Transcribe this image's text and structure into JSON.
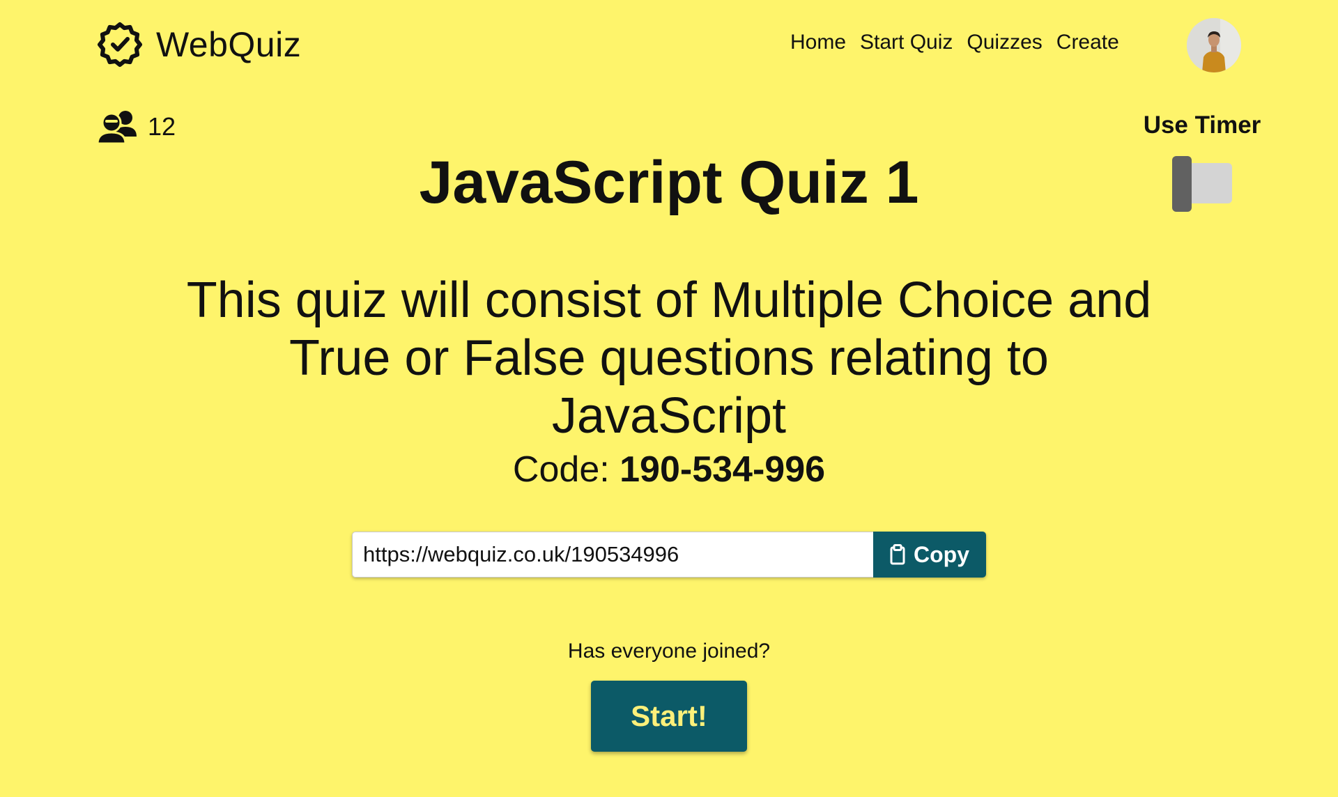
{
  "header": {
    "brand": "WebQuiz",
    "logo_icon": "badge-check-icon",
    "nav": [
      {
        "label": "Home"
      },
      {
        "label": "Start Quiz"
      },
      {
        "label": "Quizzes"
      },
      {
        "label": "Create"
      }
    ],
    "avatar_icon": "user-avatar"
  },
  "lobby": {
    "participants_icon": "users-icon",
    "participant_count": "12",
    "timer_label": "Use Timer",
    "timer_enabled": false,
    "title": "JavaScript Quiz 1",
    "description": "This quiz will consist of Multiple Choice and True or False questions relating to JavaScript",
    "code_label": "Code:",
    "code_value": "190-534-996",
    "share_url": "https://webquiz.co.uk/190534996",
    "copy_label": "Copy",
    "copy_icon": "clipboard-icon",
    "joined_prompt": "Has everyone joined?",
    "start_label": "Start!"
  },
  "colors": {
    "background": "#fef46b",
    "accent": "#0c5a67",
    "start_text": "#fdf07a",
    "toggle_track": "#d4d4d4",
    "toggle_knob": "#616161"
  }
}
